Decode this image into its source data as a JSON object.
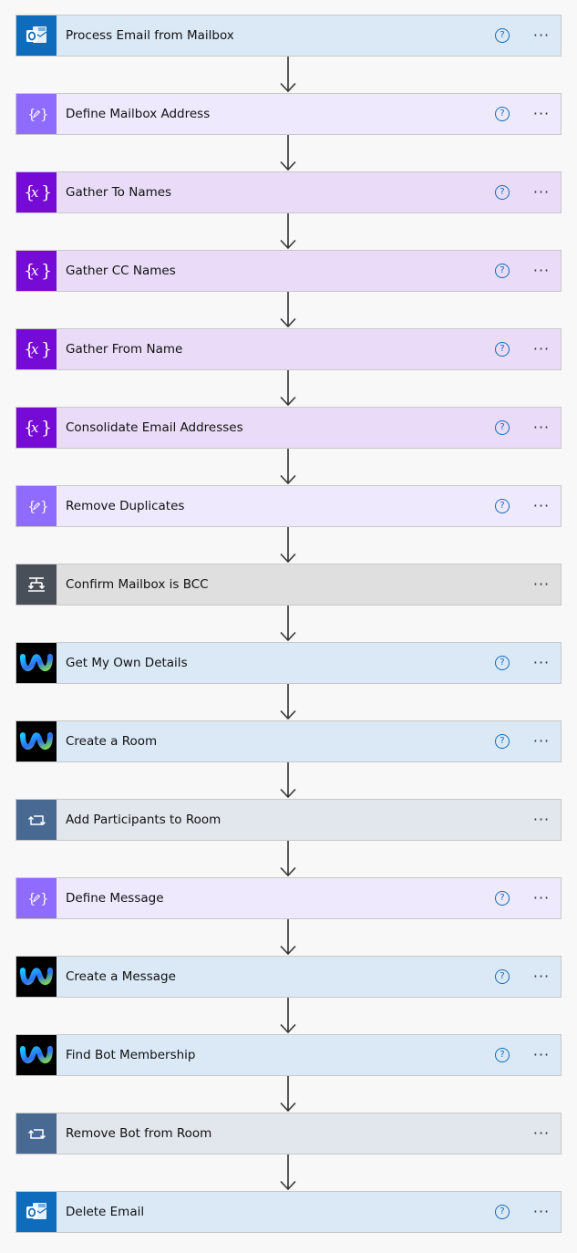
{
  "help_glyph": "?",
  "more_glyph": "···",
  "steps": [
    {
      "label": "Process Email from Mailbox",
      "icon": "outlook-icon",
      "theme": "outlook",
      "help": true
    },
    {
      "label": "Define Mailbox Address",
      "icon": "variable-edit-icon",
      "theme": "var-light",
      "help": true
    },
    {
      "label": "Gather To Names",
      "icon": "variable-x-icon",
      "theme": "var",
      "help": true
    },
    {
      "label": "Gather CC Names",
      "icon": "variable-x-icon",
      "theme": "var",
      "help": true
    },
    {
      "label": "Gather From Name",
      "icon": "variable-x-icon",
      "theme": "var",
      "help": true
    },
    {
      "label": "Consolidate Email Addresses",
      "icon": "variable-x-icon",
      "theme": "var",
      "help": true
    },
    {
      "label": "Remove Duplicates",
      "icon": "variable-edit-icon",
      "theme": "var-light",
      "help": true
    },
    {
      "label": "Confirm Mailbox is BCC",
      "icon": "condition-icon",
      "theme": "cond",
      "help": false
    },
    {
      "label": "Get My Own Details",
      "icon": "webex-icon",
      "theme": "webex",
      "help": true
    },
    {
      "label": "Create a Room",
      "icon": "webex-icon",
      "theme": "webex",
      "help": true
    },
    {
      "label": "Add Participants to Room",
      "icon": "loop-icon",
      "theme": "loop",
      "help": false
    },
    {
      "label": "Define Message",
      "icon": "variable-edit-icon",
      "theme": "var-light",
      "help": true
    },
    {
      "label": "Create a Message",
      "icon": "webex-icon",
      "theme": "webex",
      "help": true
    },
    {
      "label": "Find Bot Membership",
      "icon": "webex-icon",
      "theme": "webex",
      "help": true
    },
    {
      "label": "Remove Bot from Room",
      "icon": "loop-icon",
      "theme": "loop",
      "help": false
    },
    {
      "label": "Delete Email",
      "icon": "outlook-icon",
      "theme": "outlook",
      "help": true
    }
  ]
}
